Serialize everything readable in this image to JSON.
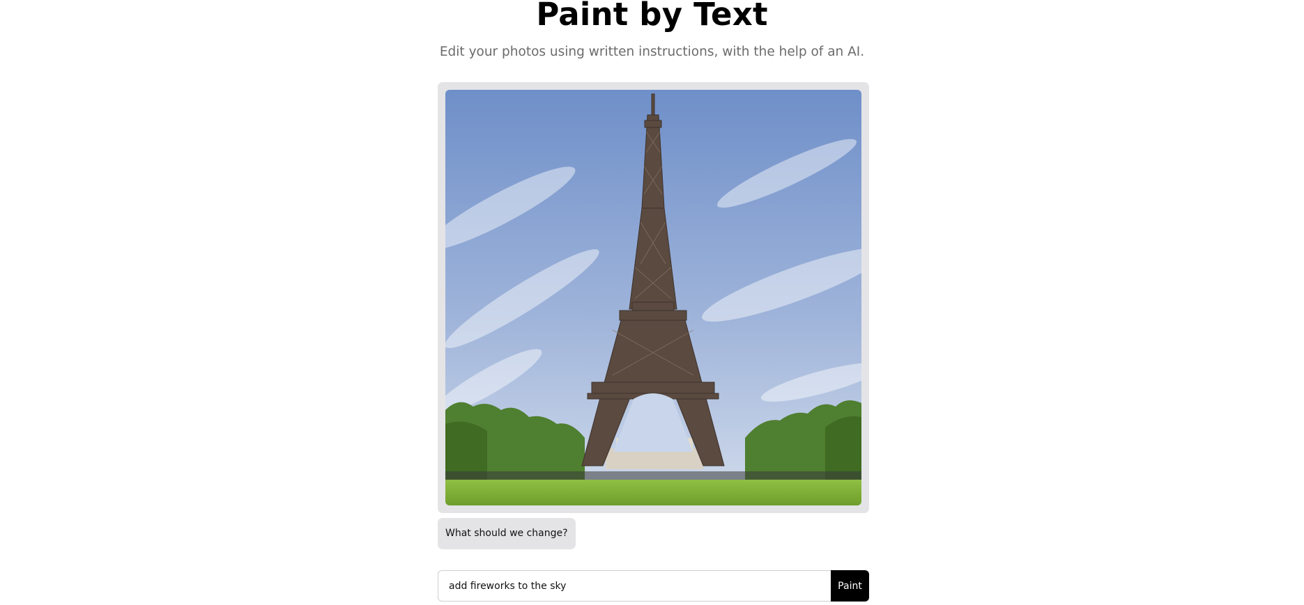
{
  "header": {
    "title": "Paint by Text",
    "subtitle": "Edit your photos using written instructions, with the help of an AI."
  },
  "photo": {
    "subject": "eiffel-tower-photo",
    "colors": {
      "frame": "#e4e4e7",
      "sky_top": "#6f8fc9",
      "sky_bottom": "#c4d2e8",
      "tower": "#5a4a40",
      "trees": "#4f7f30",
      "grass": "#7fae35"
    }
  },
  "chat": {
    "prompt_question": "What should we change?"
  },
  "form": {
    "input_value": "add fireworks to the sky",
    "submit_label": "Paint",
    "accent_color": "#000000"
  }
}
